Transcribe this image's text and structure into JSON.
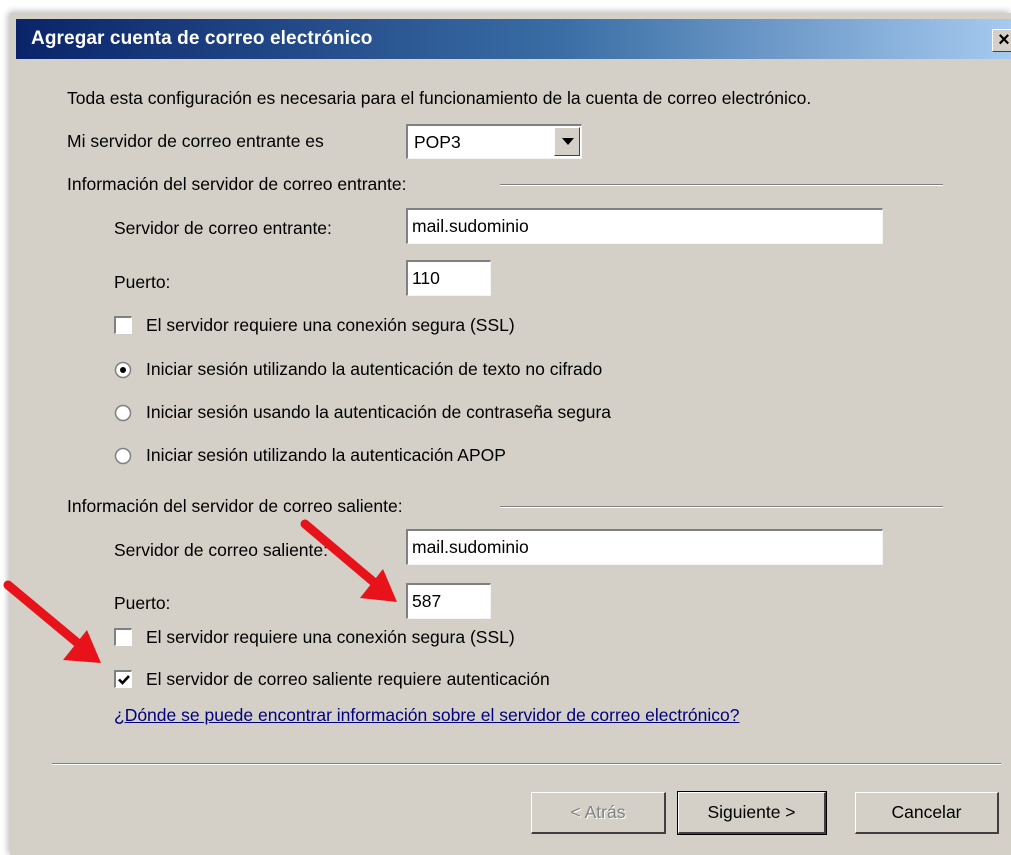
{
  "window": {
    "title": "Agregar cuenta de correo electrónico",
    "close_label": "×",
    "titlebar_colors": [
      "#0a246a",
      "#a6caf0"
    ]
  },
  "intro_text": "Toda esta configuración es necesaria para el funcionamiento de la cuenta de correo electrónico.",
  "incoming_type": {
    "label": "Mi servidor de correo entrante es",
    "value": "POP3"
  },
  "incoming": {
    "group_label": "Información del servidor de correo entrante:",
    "server_label": "Servidor de correo entrante:",
    "server_value": "mail.sudominio",
    "port_label": "Puerto:",
    "port_value": "110",
    "ssl_label": "El servidor requiere una conexión segura (SSL)",
    "ssl_checked": false,
    "auth_options": [
      {
        "label": "Iniciar sesión utilizando la autenticación de texto no cifrado",
        "selected": true
      },
      {
        "label": "Iniciar sesión usando la autenticación de contraseña segura",
        "selected": false
      },
      {
        "label": "Iniciar sesión utilizando la autenticación APOP",
        "selected": false
      }
    ]
  },
  "outgoing": {
    "group_label": "Información del servidor de correo saliente:",
    "server_label": "Servidor de correo saliente:",
    "server_value": "mail.sudominio",
    "port_label": "Puerto:",
    "port_value": "587",
    "ssl_label": "El servidor requiere una conexión segura (SSL)",
    "ssl_checked": false,
    "auth_label": "El servidor de correo saliente requiere autenticación",
    "auth_checked": true
  },
  "help_link": "¿Dónde se puede encontrar información sobre el servidor de correo electrónico?",
  "buttons": {
    "back": "< Atrás",
    "next": "Siguiente >",
    "cancel": "Cancelar"
  },
  "annotation_color": "#e8121a"
}
